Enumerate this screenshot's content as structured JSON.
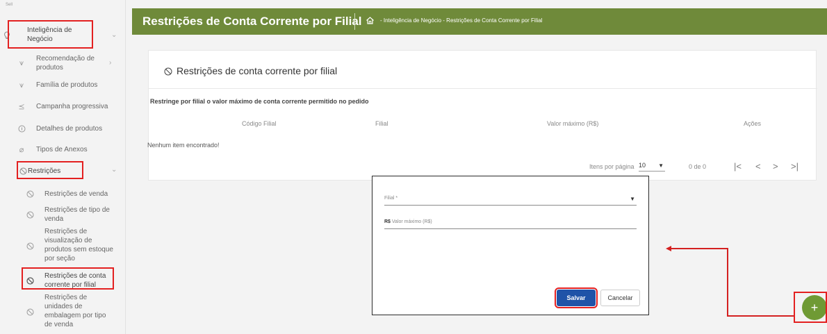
{
  "sidebar": {
    "top_label": "Sell",
    "section": {
      "label": "Inteligência de Negócio"
    },
    "items": [
      {
        "label": "Recomendação de produtos"
      },
      {
        "label": "Família de produtos"
      },
      {
        "label": "Campanha progressiva"
      },
      {
        "label": "Detalhes de produtos"
      },
      {
        "label": "Tipos de Anexos"
      },
      {
        "label": "Restrições"
      }
    ],
    "subitems": [
      {
        "label": "Restrições de venda"
      },
      {
        "label": "Restrições de tipo de venda"
      },
      {
        "label": "Restrições de visualização de produtos sem estoque por seção"
      },
      {
        "label": "Restrições de conta corrente por filial"
      },
      {
        "label": "Restrições de unidades de embalagem por tipo de venda"
      }
    ]
  },
  "header": {
    "title": "Restrições de Conta Corrente por Filial",
    "breadcrumb": "- Inteligência de Negócio - Restrições de Conta Corrente por Filial"
  },
  "card": {
    "title": "Restrições de conta corrente por filial",
    "subtitle": "Restringe por filial o valor máximo de conta corrente permitido no pedido",
    "columns": [
      "Código Filial",
      "Filial",
      "Valor máximo (R$)",
      "Ações"
    ],
    "empty_text": "Nenhum item encontrado!",
    "pager": {
      "label": "Itens por página",
      "page_size": "10",
      "count": "0 de 0"
    }
  },
  "dialog": {
    "filial_label": "Filial *",
    "valor_prefix": "R$",
    "valor_placeholder": "Valor máximo (R$)",
    "save_label": "Salvar",
    "cancel_label": "Cancelar"
  },
  "fab": {
    "label": "+"
  },
  "colors": {
    "header": "#6f8a3a",
    "save": "#1f53a8",
    "fab": "#6f9a34",
    "annotation": "#e32020"
  }
}
